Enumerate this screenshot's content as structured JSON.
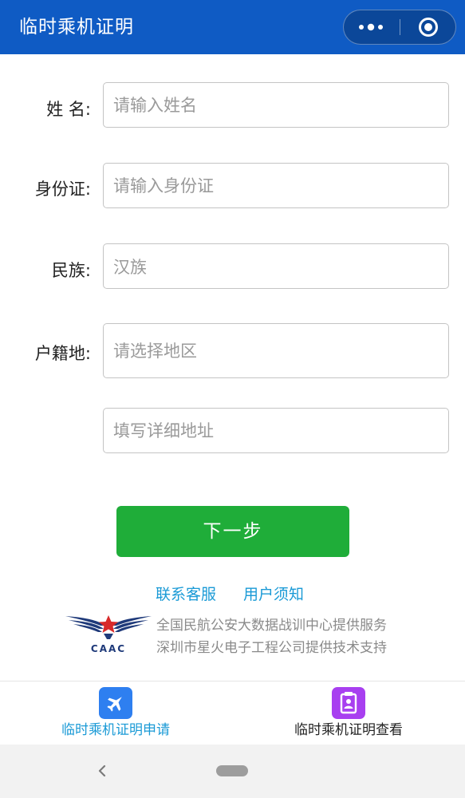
{
  "header": {
    "title": "临时乘机证明",
    "bg_color": "#0f5bc4",
    "more_icon": "more-dots-icon",
    "close_icon": "target-circle-icon"
  },
  "form": {
    "name": {
      "label": "姓 名:",
      "placeholder": "请输入姓名"
    },
    "id_card": {
      "label": "身份证:",
      "placeholder": "请输入身份证"
    },
    "ethnicity": {
      "label": "民族:",
      "value": "汉族"
    },
    "hometown": {
      "label": "户籍地:",
      "placeholder": "请选择地区"
    },
    "address": {
      "placeholder": "填写详细地址"
    }
  },
  "next_button": {
    "label": "下一步",
    "color": "#1fad39"
  },
  "links": {
    "contact": "联系客服",
    "notice": "用户须知",
    "color": "#1a9ad6"
  },
  "footer": {
    "logo_text": "CAAC",
    "credit_line_1": "全国民航公安大数据战训中心提供服务",
    "credit_line_2": "深圳市星火电子工程公司提供技术支持"
  },
  "tabbar": {
    "tab_apply": {
      "label": "临时乘机证明申请",
      "icon": "airplane-icon",
      "color": "#1a9ad6",
      "icon_bg": "#2e7ff0"
    },
    "tab_view": {
      "label": "临时乘机证明查看",
      "icon": "id-card-icon",
      "color": "#222222",
      "icon_bg": "#a83ff0"
    }
  },
  "system_nav": {
    "back_icon": "chevron-left-icon",
    "home_icon": "home-pill-icon"
  }
}
